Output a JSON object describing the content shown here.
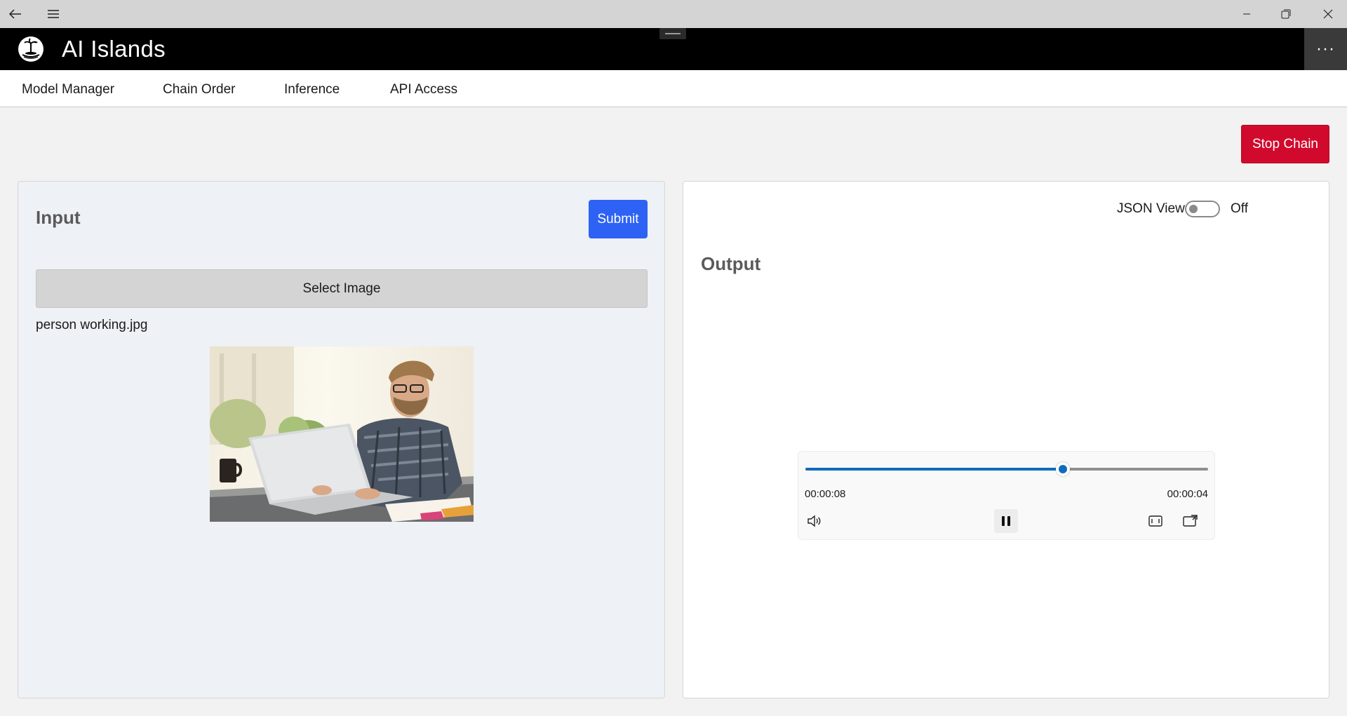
{
  "window": {
    "back_icon": "back-arrow-icon",
    "menu_icon": "hamburger-menu-icon",
    "controls": [
      "minimize",
      "restore",
      "close"
    ]
  },
  "app": {
    "title": "AI Islands",
    "more_label": "···"
  },
  "nav": {
    "items": [
      "Model Manager",
      "Chain Order",
      "Inference",
      "API Access"
    ]
  },
  "toolbar": {
    "stop_label": "Stop Chain",
    "stop_color": "#d10a2d"
  },
  "input": {
    "title": "Input",
    "submit_label": "Submit",
    "submit_color": "#2d62f5",
    "select_label": "Select Image",
    "filename": "person working.jpg"
  },
  "output": {
    "title": "Output",
    "json_view_label": "JSON View",
    "json_view_state": "Off",
    "player": {
      "elapsed": "00:00:08",
      "remaining": "00:00:04",
      "progress": 0.64,
      "state": "playing",
      "accent": "#0f6cbd"
    }
  }
}
